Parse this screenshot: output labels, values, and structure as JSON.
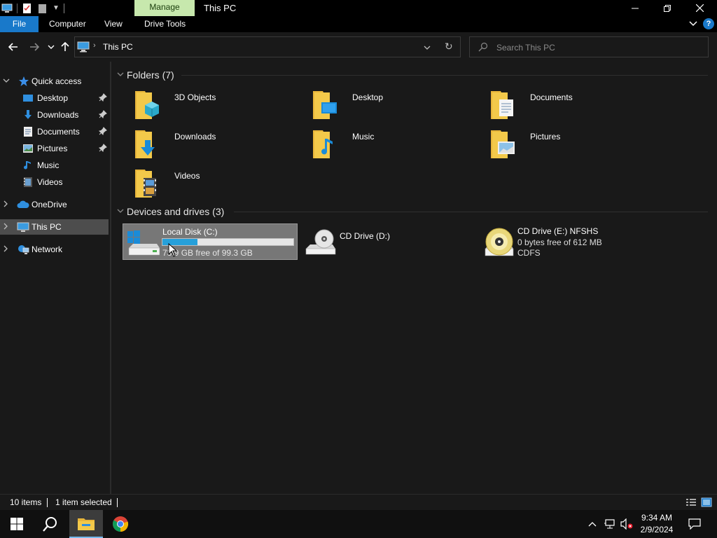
{
  "window": {
    "title": "This PC",
    "manage_tab": "Manage"
  },
  "ribbon": {
    "tabs": [
      {
        "label": "File"
      },
      {
        "label": "Computer"
      },
      {
        "label": "View"
      },
      {
        "label": "Drive Tools"
      }
    ]
  },
  "address": {
    "crumb": "This PC",
    "search_placeholder": "Search This PC"
  },
  "sidebar": {
    "quick_access": "Quick access",
    "items": [
      {
        "label": "Desktop",
        "icon": "desktop-icon",
        "pinned": true
      },
      {
        "label": "Downloads",
        "icon": "downloads-icon",
        "pinned": true
      },
      {
        "label": "Documents",
        "icon": "documents-icon",
        "pinned": true
      },
      {
        "label": "Pictures",
        "icon": "pictures-icon",
        "pinned": true
      },
      {
        "label": "Music",
        "icon": "music-icon",
        "pinned": false
      },
      {
        "label": "Videos",
        "icon": "videos-icon",
        "pinned": false
      }
    ],
    "onedrive": "OneDrive",
    "this_pc": "This PC",
    "network": "Network"
  },
  "folders": {
    "header": "Folders (7)",
    "items": [
      {
        "name": "3D Objects",
        "icon": "3d-objects-icon"
      },
      {
        "name": "Desktop",
        "icon": "desktop-folder-icon"
      },
      {
        "name": "Documents",
        "icon": "documents-folder-icon"
      },
      {
        "name": "Downloads",
        "icon": "downloads-folder-icon"
      },
      {
        "name": "Music",
        "icon": "music-folder-icon"
      },
      {
        "name": "Pictures",
        "icon": "pictures-folder-icon"
      },
      {
        "name": "Videos",
        "icon": "videos-folder-icon"
      }
    ]
  },
  "drives": {
    "header": "Devices and drives (3)",
    "local_disk": {
      "name": "Local Disk (C:)",
      "free_text": "73.9 GB free of 99.3 GB",
      "used_fraction": 0.27
    },
    "cd_d": {
      "name": "CD Drive (D:)"
    },
    "cd_e": {
      "name": "CD Drive (E:) NFSHS",
      "free_text": "0 bytes free of 612 MB",
      "fs": "CDFS"
    }
  },
  "status": {
    "items": "10 items",
    "selected": "1 item selected"
  },
  "taskbar": {
    "time": "9:34 AM",
    "date": "2/9/2024"
  },
  "colors": {
    "accent": "#1979ca",
    "manage_tab": "#c7e8ad",
    "folder": "#f3c94a",
    "progress": "#26a0da"
  }
}
